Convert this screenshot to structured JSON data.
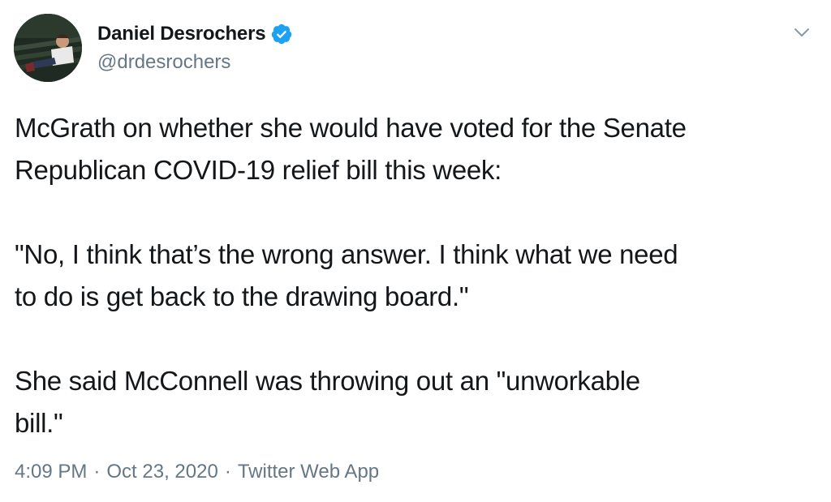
{
  "author": {
    "display_name": "Daniel Desrochers",
    "handle": "@drdesrochers",
    "verified": true,
    "avatar_icon": "user-avatar-photo"
  },
  "menu": {
    "icon": "chevron-down-icon"
  },
  "tweet": {
    "paragraphs": [
      "McGrath on whether she would have voted for the Senate\nRepublican COVID-19 relief bill this week:",
      "\"No, I think that’s the wrong answer. I think what we need\nto do is get back to the drawing board.\"",
      "She said McConnell was throwing out an \"unworkable\nbill.\""
    ]
  },
  "meta": {
    "time": "4:09 PM",
    "separator": "·",
    "date": "Oct 23, 2020",
    "source": "Twitter Web App"
  },
  "colors": {
    "verified_blue": "#1da1f2",
    "secondary_text": "#657786",
    "primary_text": "#14171a"
  }
}
